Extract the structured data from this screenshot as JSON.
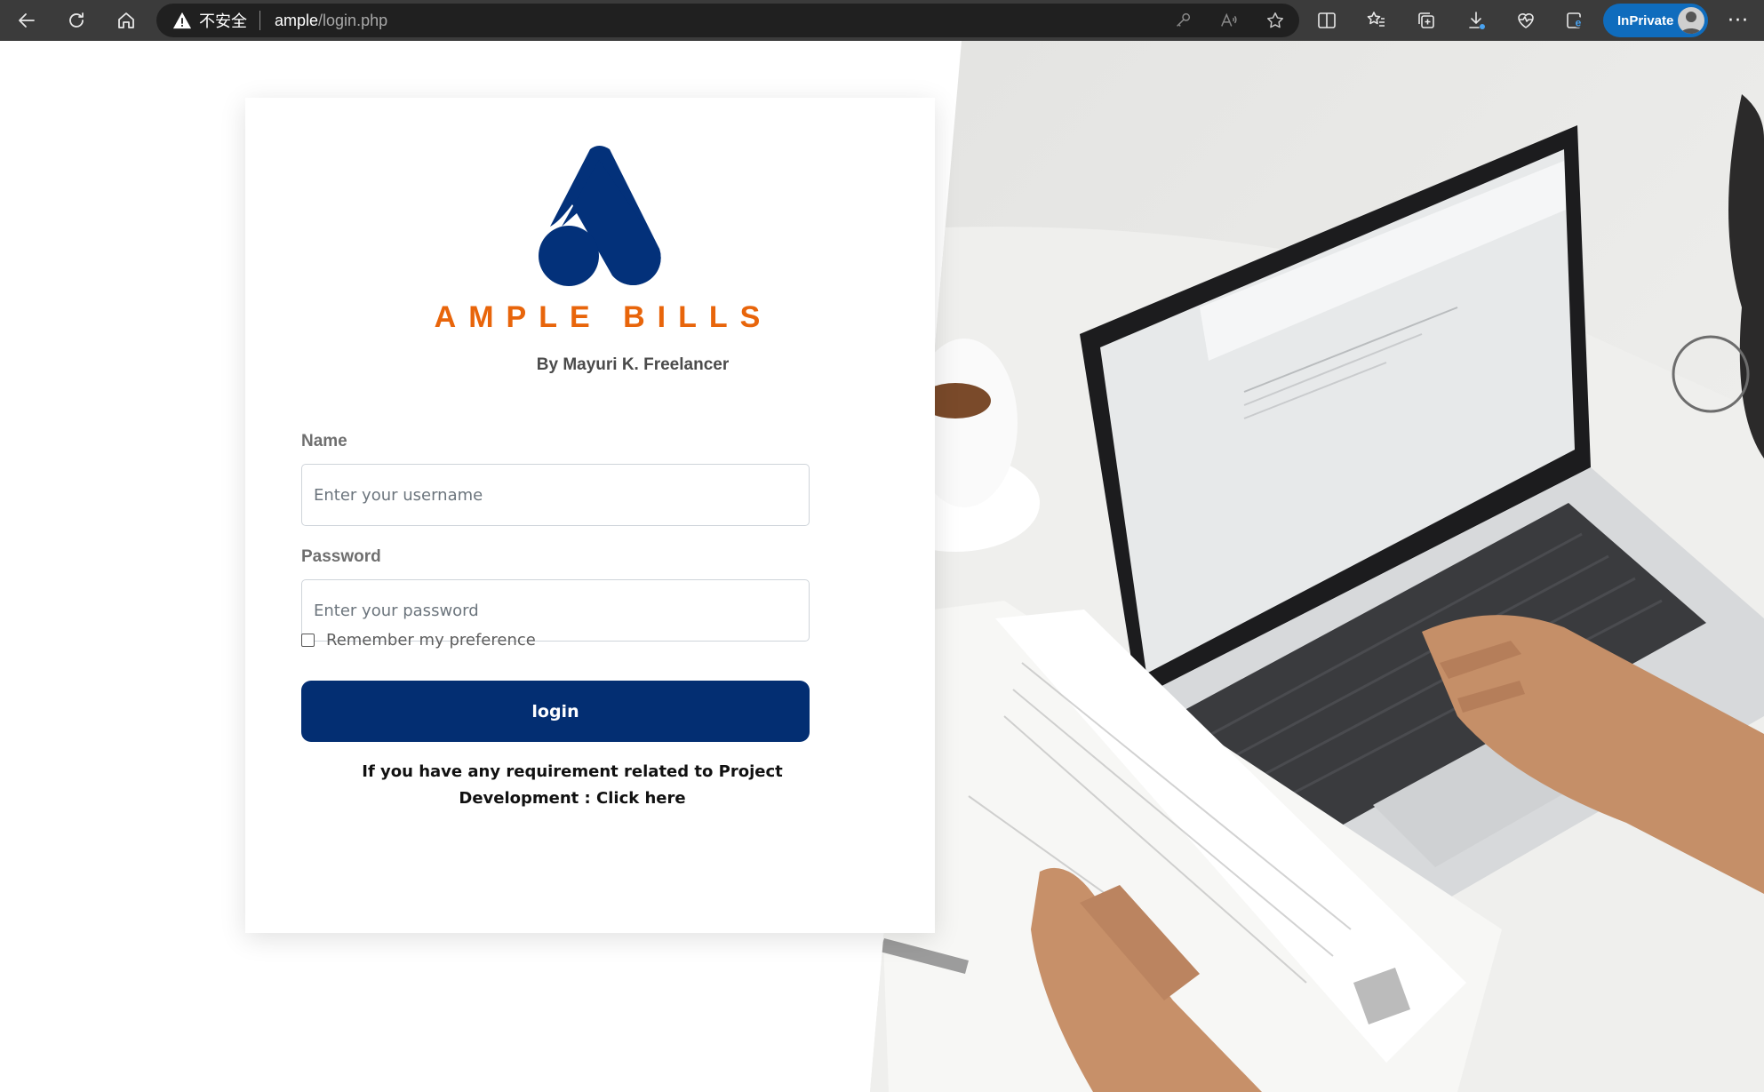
{
  "browser": {
    "security_text": "不安全",
    "url_host": "ample",
    "url_path": "/login.php",
    "inprivate_label": "InPrivate",
    "more_label": "···",
    "colors": {
      "chrome": "#3b3b3b",
      "address_bar": "#202020",
      "inprivate": "#0f6cbd"
    }
  },
  "login": {
    "brand_name": "AMPLE BILLS",
    "byline": "By Mayuri K. Freelancer",
    "name_label": "Name",
    "name_placeholder": "Enter your username",
    "name_value": "",
    "password_label": "Password",
    "password_placeholder": "Enter your password",
    "password_value": "",
    "remember_label": "Remember my preference",
    "remember_checked": false,
    "login_button": "login",
    "requirement_text": "If you have any requirement related to Project Development : ",
    "requirement_link": "Click here",
    "colors": {
      "primary": "#032e72",
      "brand_orange": "#e8650b",
      "logo_blue": "#03317a"
    }
  }
}
